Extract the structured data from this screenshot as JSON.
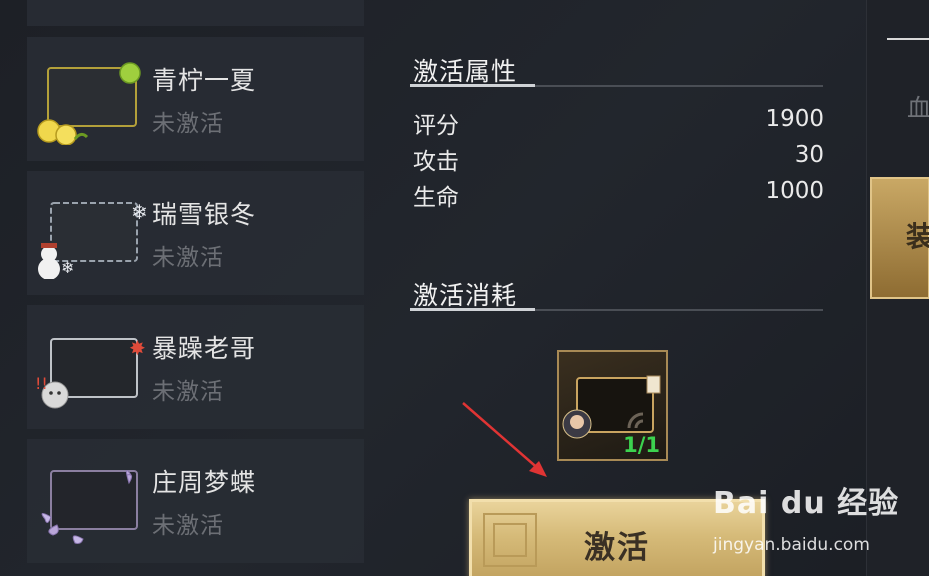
{
  "frames": [
    {
      "name": "青柠一夏",
      "status": "未激活",
      "icon": "lemon-frame-icon"
    },
    {
      "name": "瑞雪银冬",
      "status": "未激活",
      "icon": "snow-frame-icon"
    },
    {
      "name": "暴躁老哥",
      "status": "未激活",
      "icon": "angry-frame-icon"
    },
    {
      "name": "庄周梦蝶",
      "status": "未激活",
      "icon": "butterfly-frame-icon"
    }
  ],
  "attributes": {
    "title": "激活属性",
    "rows": [
      {
        "key": "评分",
        "value": "1900"
      },
      {
        "key": "攻击",
        "value": "30"
      },
      {
        "key": "生命",
        "value": "1000"
      }
    ]
  },
  "cost": {
    "title": "激活消耗",
    "count": "1/1",
    "icon": "avatar-frame-item-icon"
  },
  "activate_button": {
    "label": "激活"
  },
  "right_panel": {
    "label": "血",
    "gold_tab": "装"
  },
  "watermark": {
    "logo": "Bai du 经验",
    "url": "jingyan.baidu.com"
  },
  "colors": {
    "accent_gold": "#d6bb79",
    "count_green": "#3cd24f",
    "inactive_gray": "#6c6f75"
  }
}
